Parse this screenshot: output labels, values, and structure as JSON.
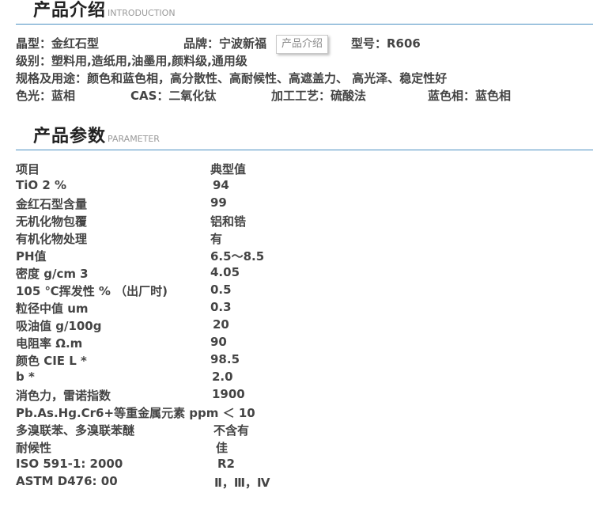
{
  "intro_section": {
    "title": "产品介绍",
    "subtitle": "INTRODUCTION",
    "crystal": "晶型：金红石型",
    "brand": "品牌：宁波新福",
    "model": "型号：R606",
    "tooltip": "产品介绍",
    "grade": "级别：塑料用,造纸用,油墨用,颜料级,通用级",
    "spec_usage": "规格及用途：颜色和蓝色相，高分散性、高耐候性、高遮盖力、 高光泽、稳定性好",
    "color_light": "色光：蓝相",
    "cas": "CAS：二氧化钛",
    "process": "加工工艺：硫酸法",
    "blue_phase": "蓝色相：蓝色相"
  },
  "param_section": {
    "title": "产品参数",
    "subtitle": "PARAMETER",
    "rows": [
      {
        "name": "项目",
        "value": "典型值"
      },
      {
        "name": "TiO 2 %",
        "value": "94"
      },
      {
        "name": "金红石型含量",
        "value": "99"
      },
      {
        "name": "无机化物包覆",
        "value": "铝和锆"
      },
      {
        "name": "有机化物处理",
        "value": "有"
      },
      {
        "name": "PH值",
        "value": "6.5～8.5"
      },
      {
        "name": "密度 g/cm 3",
        "value": "4.05"
      },
      {
        "name": "105 ℃挥发性 % （出厂时)",
        "value": "0.5"
      },
      {
        "name": "粒径中值 um",
        "value": "0.3"
      },
      {
        "name": "吸油值 g/100g",
        "value": "20"
      },
      {
        "name": "电阻率 Ω.m",
        "value": "90"
      },
      {
        "name": "颜色 CIE L *",
        "value": "98.5"
      },
      {
        "name": "b *",
        "value": "2.0"
      },
      {
        "name": "消色力，雷诺指数",
        "value": "1900"
      },
      {
        "name": "Pb.As.Hg.Cr6+等重金属元素 ppm ＜ 10",
        "value": ""
      },
      {
        "name": "多溴联苯、多溴联苯醚",
        "value": "不含有"
      },
      {
        "name": "耐候性",
        "value": "佳"
      },
      {
        "name": "ISO 591-1: 2000",
        "value": "R2"
      },
      {
        "name": "ASTM D476: 00",
        "value": "Ⅱ，Ⅲ，Ⅳ"
      }
    ]
  }
}
